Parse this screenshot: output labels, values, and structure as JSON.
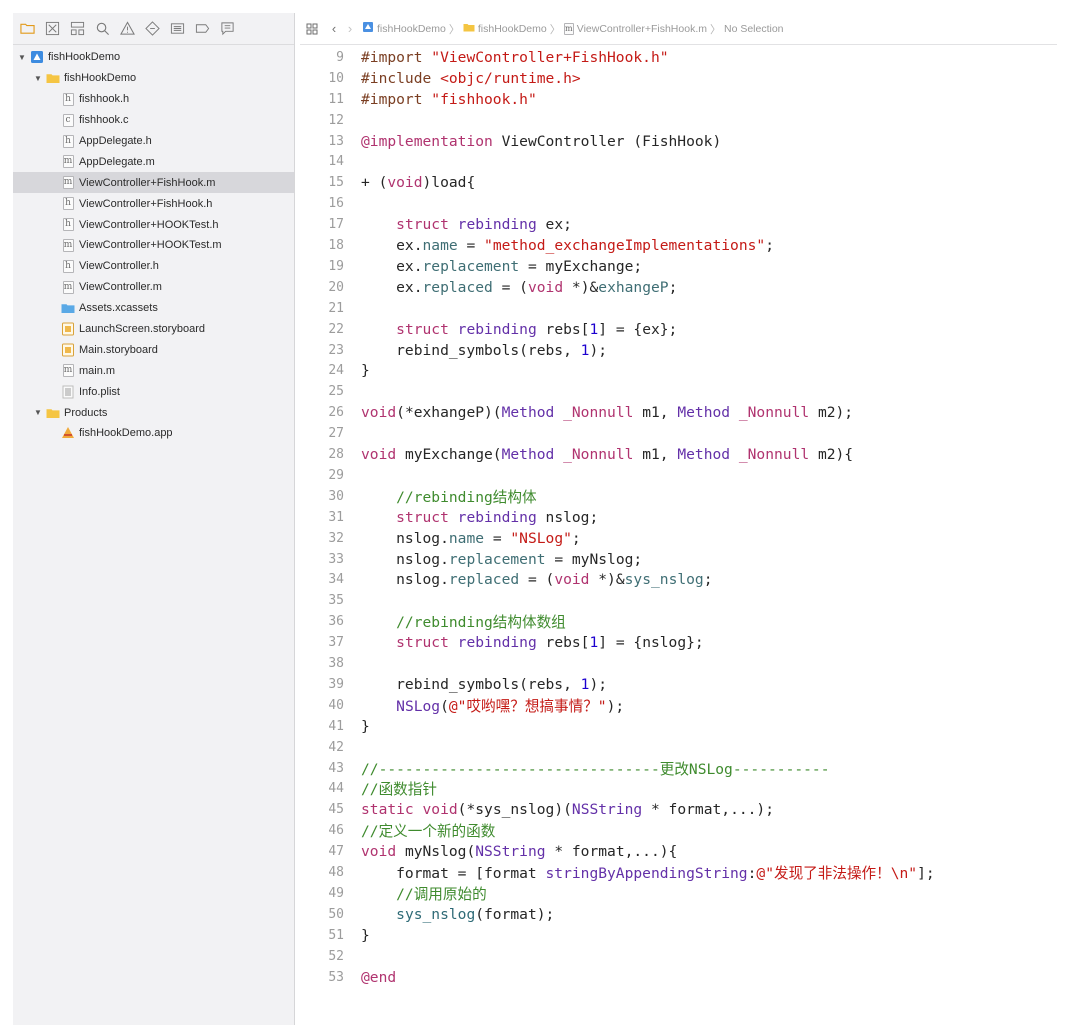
{
  "navigator": {
    "toolbar_icons": [
      "folder-icon",
      "source-control-icon",
      "hierarchy-icon",
      "search-icon",
      "warning-icon",
      "test-icon",
      "debug-icon",
      "breakpoint-icon",
      "report-icon"
    ],
    "tree": [
      {
        "label": "fishHookDemo",
        "icon": "project-icon",
        "level": 0,
        "disclosure": "▼"
      },
      {
        "label": "fishHookDemo",
        "icon": "folder-icon",
        "level": 1,
        "disclosure": "▼"
      },
      {
        "label": "fishhook.h",
        "icon": "h",
        "level": 2
      },
      {
        "label": "fishhook.c",
        "icon": "c",
        "level": 2
      },
      {
        "label": "AppDelegate.h",
        "icon": "h",
        "level": 2
      },
      {
        "label": "AppDelegate.m",
        "icon": "m",
        "level": 2
      },
      {
        "label": "ViewController+FishHook.m",
        "icon": "m",
        "level": 2,
        "selected": true
      },
      {
        "label": "ViewController+FishHook.h",
        "icon": "h",
        "level": 2
      },
      {
        "label": "ViewController+HOOKTest.h",
        "icon": "h",
        "level": 2
      },
      {
        "label": "ViewController+HOOKTest.m",
        "icon": "m",
        "level": 2
      },
      {
        "label": "ViewController.h",
        "icon": "h",
        "level": 2
      },
      {
        "label": "ViewController.m",
        "icon": "m",
        "level": 2
      },
      {
        "label": "Assets.xcassets",
        "icon": "assets",
        "level": 2
      },
      {
        "label": "LaunchScreen.storyboard",
        "icon": "storyboard",
        "level": 2
      },
      {
        "label": "Main.storyboard",
        "icon": "storyboard",
        "level": 2
      },
      {
        "label": "main.m",
        "icon": "m",
        "level": 2
      },
      {
        "label": "Info.plist",
        "icon": "plist",
        "level": 2
      },
      {
        "label": "Products",
        "icon": "folder-icon",
        "level": 1,
        "disclosure": "▼"
      },
      {
        "label": "fishHookDemo.app",
        "icon": "app",
        "level": 2
      }
    ]
  },
  "jumpbar": {
    "crumbs": [
      "fishHookDemo",
      "fishHookDemo",
      "ViewController+FishHook.m",
      "No Selection"
    ]
  },
  "code": {
    "first_line": 9,
    "lines": [
      [
        [
          "pre",
          "#import "
        ],
        [
          "str",
          "\"ViewController+FishHook.h\""
        ]
      ],
      [
        [
          "pre",
          "#include "
        ],
        [
          "str",
          "<objc/runtime.h>"
        ]
      ],
      [
        [
          "pre",
          "#import "
        ],
        [
          "str",
          "\"fishhook.h\""
        ]
      ],
      [],
      [
        [
          "kw",
          "@implementation"
        ],
        [
          "",
          " ViewController (FishHook)"
        ]
      ],
      [],
      [
        [
          "",
          "+ ("
        ],
        [
          "kw",
          "void"
        ],
        [
          "",
          ")load{"
        ]
      ],
      [],
      [
        [
          "",
          "    "
        ],
        [
          "kw",
          "struct"
        ],
        [
          "",
          " "
        ],
        [
          "ty",
          "rebinding"
        ],
        [
          "",
          " ex;"
        ]
      ],
      [
        [
          "",
          "    ex."
        ],
        [
          "prop",
          "name"
        ],
        [
          "",
          " = "
        ],
        [
          "str",
          "\"method_exchangeImplementations\""
        ],
        [
          "",
          ";"
        ]
      ],
      [
        [
          "",
          "    ex."
        ],
        [
          "prop",
          "replacement"
        ],
        [
          "",
          " = myExchange;"
        ]
      ],
      [
        [
          "",
          "    ex."
        ],
        [
          "prop",
          "replaced"
        ],
        [
          "",
          " = ("
        ],
        [
          "kw",
          "void"
        ],
        [
          "",
          " *)&"
        ],
        [
          "prop",
          "exhangeP"
        ],
        [
          "",
          ";"
        ]
      ],
      [],
      [
        [
          "",
          "    "
        ],
        [
          "kw",
          "struct"
        ],
        [
          "",
          " "
        ],
        [
          "ty",
          "rebinding"
        ],
        [
          "",
          " rebs["
        ],
        [
          "num",
          "1"
        ],
        [
          "",
          "] = {ex};"
        ]
      ],
      [
        [
          "",
          "    rebind_symbols(rebs, "
        ],
        [
          "num",
          "1"
        ],
        [
          "",
          ");"
        ]
      ],
      [
        [
          "",
          "}"
        ]
      ],
      [],
      [
        [
          "kw",
          "void"
        ],
        [
          "",
          "(*exhangeP)("
        ],
        [
          "ty",
          "Method"
        ],
        [
          "",
          " "
        ],
        [
          "kw",
          "_Nonnull"
        ],
        [
          "",
          " m1, "
        ],
        [
          "ty",
          "Method"
        ],
        [
          "",
          " "
        ],
        [
          "kw",
          "_Nonnull"
        ],
        [
          "",
          " m2);"
        ]
      ],
      [],
      [
        [
          "kw",
          "void"
        ],
        [
          "",
          " myExchange("
        ],
        [
          "ty",
          "Method"
        ],
        [
          "",
          " "
        ],
        [
          "kw",
          "_Nonnull"
        ],
        [
          "",
          " m1, "
        ],
        [
          "ty",
          "Method"
        ],
        [
          "",
          " "
        ],
        [
          "kw",
          "_Nonnull"
        ],
        [
          "",
          " m2){"
        ]
      ],
      [],
      [
        [
          "cm",
          "    //rebinding结构体"
        ]
      ],
      [
        [
          "",
          "    "
        ],
        [
          "kw",
          "struct"
        ],
        [
          "",
          " "
        ],
        [
          "ty",
          "rebinding"
        ],
        [
          "",
          " nslog;"
        ]
      ],
      [
        [
          "",
          "    nslog."
        ],
        [
          "prop",
          "name"
        ],
        [
          "",
          " = "
        ],
        [
          "str",
          "\"NSLog\""
        ],
        [
          "",
          ";"
        ]
      ],
      [
        [
          "",
          "    nslog."
        ],
        [
          "prop",
          "replacement"
        ],
        [
          "",
          " = myNslog;"
        ]
      ],
      [
        [
          "",
          "    nslog."
        ],
        [
          "prop",
          "replaced"
        ],
        [
          "",
          " = ("
        ],
        [
          "kw",
          "void"
        ],
        [
          "",
          " *)&"
        ],
        [
          "prop",
          "sys_nslog"
        ],
        [
          "",
          ";"
        ]
      ],
      [],
      [
        [
          "cm",
          "    //rebinding结构体数组"
        ]
      ],
      [
        [
          "",
          "    "
        ],
        [
          "kw",
          "struct"
        ],
        [
          "",
          " "
        ],
        [
          "ty",
          "rebinding"
        ],
        [
          "",
          " rebs["
        ],
        [
          "num",
          "1"
        ],
        [
          "",
          "] = {nslog};"
        ]
      ],
      [],
      [
        [
          "",
          "    rebind_symbols(rebs, "
        ],
        [
          "num",
          "1"
        ],
        [
          "",
          ");"
        ]
      ],
      [
        [
          "",
          "    "
        ],
        [
          "ty",
          "NSLog"
        ],
        [
          "",
          "("
        ],
        [
          "str",
          "@\"哎哟嘿？想搞事情？\""
        ],
        [
          "",
          ");"
        ]
      ],
      [
        [
          "",
          "}"
        ]
      ],
      [],
      [
        [
          "cm",
          "//--------------------------------更改NSLog-----------"
        ]
      ],
      [
        [
          "cm",
          "//函数指针"
        ]
      ],
      [
        [
          "kw",
          "static"
        ],
        [
          "",
          " "
        ],
        [
          "kw",
          "void"
        ],
        [
          "",
          "(*sys_nslog)("
        ],
        [
          "ty",
          "NSString"
        ],
        [
          "",
          " * format,...);"
        ]
      ],
      [
        [
          "cm",
          "//定义一个新的函数"
        ]
      ],
      [
        [
          "kw",
          "void"
        ],
        [
          "",
          " myNslog("
        ],
        [
          "ty",
          "NSString"
        ],
        [
          "",
          " * format,...){"
        ]
      ],
      [
        [
          "",
          "    format = [format "
        ],
        [
          "ty",
          "stringByAppendingString"
        ],
        [
          "",
          ":"
        ],
        [
          "str",
          "@\"发现了非法操作！\\n\""
        ],
        [
          "",
          "];"
        ]
      ],
      [
        [
          "cm",
          "    //调用原始的"
        ]
      ],
      [
        [
          "",
          "    "
        ],
        [
          "fn",
          "sys_nslog"
        ],
        [
          "",
          "(format);"
        ]
      ],
      [
        [
          "",
          "}"
        ]
      ],
      [],
      [
        [
          "kw",
          "@end"
        ]
      ]
    ]
  },
  "colors": {
    "keyword": "#b0336f",
    "string": "#c41a16",
    "comment": "#3f8b2e",
    "type": "#6330a8",
    "preprocessor": "#7a3e22",
    "property": "#3f6e74",
    "number": "#1c00cf",
    "selection": "#d7d7db",
    "sidebar_bg": "#f2f2f4"
  }
}
